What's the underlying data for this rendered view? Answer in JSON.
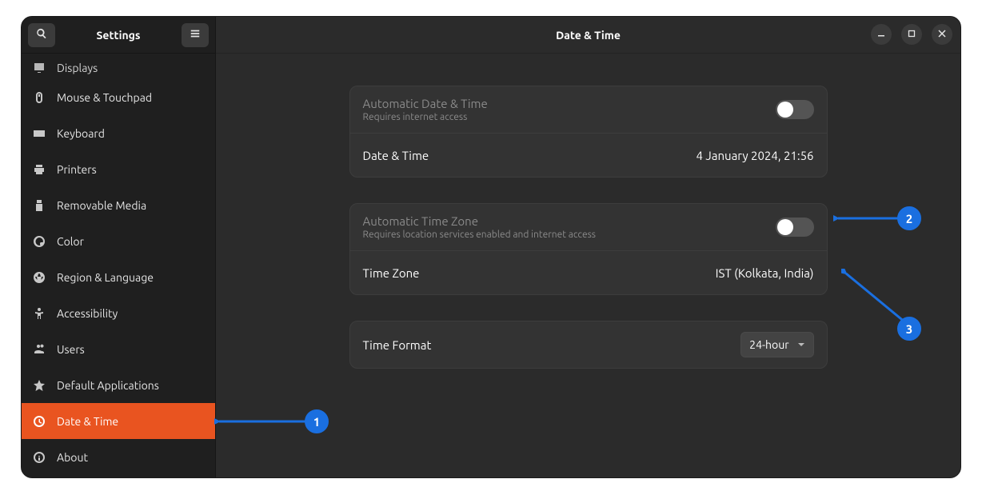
{
  "sidebar": {
    "title": "Settings",
    "items": [
      {
        "icon": "display",
        "label": "Displays"
      },
      {
        "icon": "mouse",
        "label": "Mouse & Touchpad"
      },
      {
        "icon": "keyboard",
        "label": "Keyboard"
      },
      {
        "icon": "printer",
        "label": "Printers"
      },
      {
        "icon": "usb",
        "label": "Removable Media"
      },
      {
        "icon": "color",
        "label": "Color"
      },
      {
        "icon": "region",
        "label": "Region & Language"
      },
      {
        "icon": "accessibility",
        "label": "Accessibility"
      },
      {
        "icon": "users",
        "label": "Users"
      },
      {
        "icon": "star",
        "label": "Default Applications"
      },
      {
        "icon": "clock",
        "label": "Date & Time"
      },
      {
        "icon": "info",
        "label": "About"
      }
    ]
  },
  "main": {
    "title": "Date & Time",
    "auto_dt_label": "Automatic Date & Time",
    "auto_dt_sub": "Requires internet access",
    "auto_dt_on": false,
    "dt_label": "Date & Time",
    "dt_value": "4 January 2024, 21:56",
    "auto_tz_label": "Automatic Time Zone",
    "auto_tz_sub": "Requires location services enabled and internet access",
    "auto_tz_on": false,
    "tz_label": "Time Zone",
    "tz_value": "IST (Kolkata, India)",
    "fmt_label": "Time Format",
    "fmt_value": "24-hour"
  },
  "annotations": {
    "1": "1",
    "2": "2",
    "3": "3"
  }
}
